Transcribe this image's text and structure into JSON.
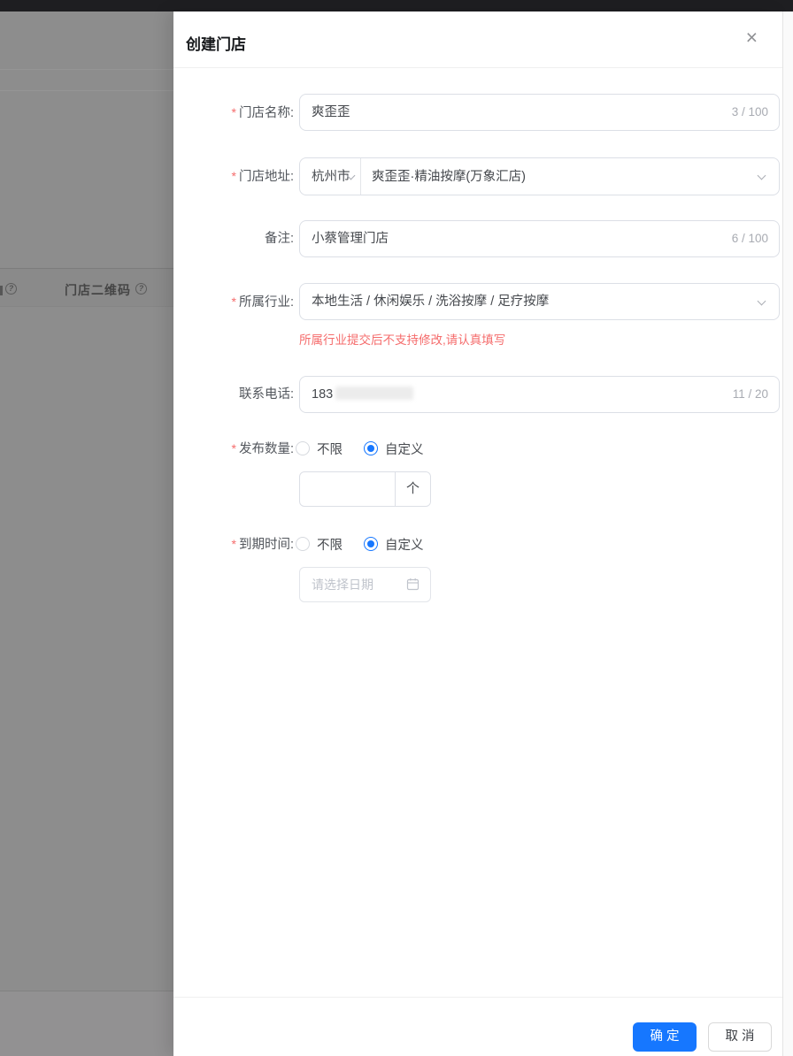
{
  "ui": {
    "required_mark": "*",
    "close_icon": "×",
    "confirm_label": "确定",
    "cancel_label": "取消"
  },
  "backdrop": {
    "column_label": "门店二维码",
    "help_mark": "?"
  },
  "drawer": {
    "title": "创建门店",
    "fields": {
      "store_name": {
        "label": "门店名称:",
        "value": "爽歪歪",
        "counter": "3 / 100"
      },
      "store_address": {
        "label": "门店地址:",
        "city": "杭州市",
        "value": "爽歪歪·精油按摩(万象汇店)"
      },
      "remark": {
        "label": "备注:",
        "value": "小蔡管理门店",
        "counter": "6 / 100"
      },
      "industry": {
        "label": "所属行业:",
        "value": "本地生活 / 休闲娱乐 / 洗浴按摩 / 足疗按摩",
        "warning": "所属行业提交后不支持修改,请认真填写"
      },
      "phone": {
        "label": "联系电话:",
        "value": "183",
        "counter": "11 / 20"
      },
      "publish_count": {
        "label": "发布数量:",
        "options": [
          {
            "label": "不限"
          },
          {
            "label": "自定义"
          }
        ],
        "value": "",
        "unit": "个"
      },
      "expire_time": {
        "label": "到期时间:",
        "options": [
          {
            "label": "不限"
          },
          {
            "label": "自定义"
          }
        ],
        "date_placeholder": "请选择日期"
      }
    }
  },
  "colors": {
    "accent": "#1677ff",
    "danger": "#f56c6c"
  }
}
